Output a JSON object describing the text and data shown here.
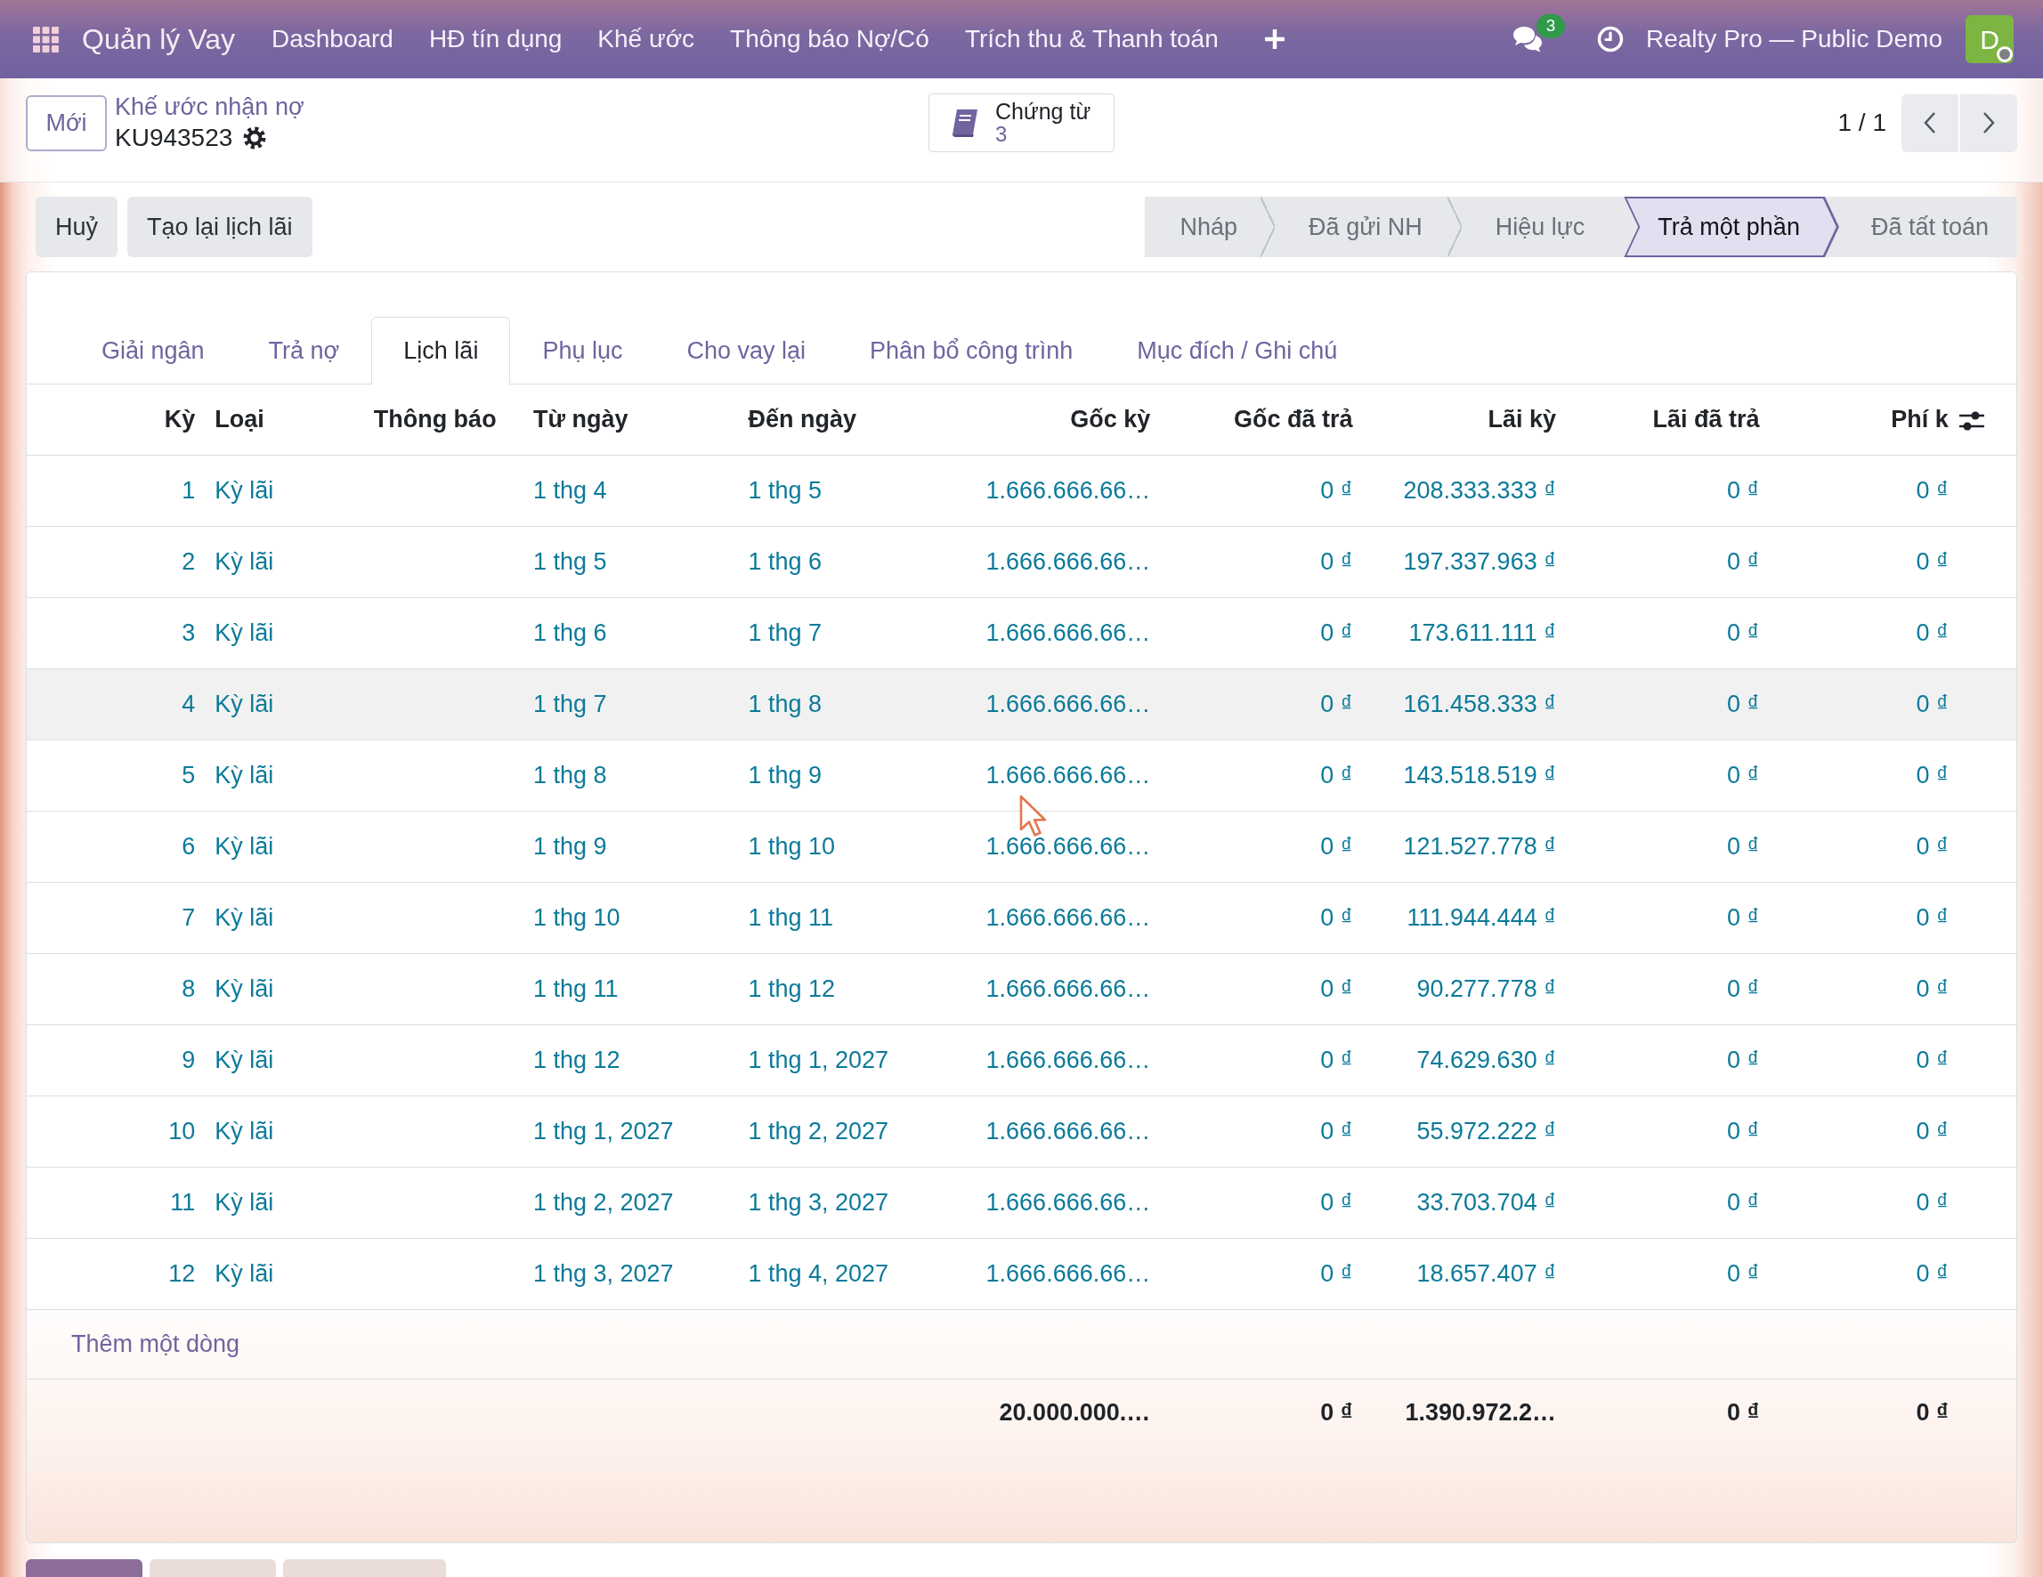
{
  "navbar": {
    "app_name": "Quản lý Vay",
    "menu": [
      "Dashboard",
      "HĐ tín dụng",
      "Khế ước",
      "Thông báo Nợ/Có",
      "Trích thu & Thanh toán"
    ],
    "message_count": "3",
    "company": "Realty Pro — Public Demo",
    "avatar_initial": "D"
  },
  "control_panel": {
    "new_button": "Mới",
    "breadcrumb": "Khế ước nhận nợ",
    "record_name": "KU943523",
    "smart_button": {
      "label": "Chứng từ",
      "count": "3"
    },
    "pager": "1 / 1"
  },
  "action_buttons": [
    "Huỷ",
    "Tạo lại lịch lãi"
  ],
  "status_bar": [
    {
      "label": "Nháp",
      "selected": false
    },
    {
      "label": "Đã gửi NH",
      "selected": false
    },
    {
      "label": "Hiệu lực",
      "selected": false
    },
    {
      "label": "Trả một phần",
      "selected": true
    },
    {
      "label": "Đã tất toán",
      "selected": false
    }
  ],
  "tabs": [
    {
      "label": "Giải ngân",
      "selected": false
    },
    {
      "label": "Trả nợ",
      "selected": false
    },
    {
      "label": "Lịch lãi",
      "selected": true
    },
    {
      "label": "Phụ lục",
      "selected": false
    },
    {
      "label": "Cho vay lại",
      "selected": false
    },
    {
      "label": "Phân bổ công trình",
      "selected": false
    },
    {
      "label": "Mục đích / Ghi chú",
      "selected": false
    }
  ],
  "table": {
    "columns": [
      {
        "label": "Kỳ",
        "kind": "number"
      },
      {
        "label": "Loại",
        "kind": "text"
      },
      {
        "label": "Thông báo",
        "kind": "text"
      },
      {
        "label": "Từ ngày",
        "kind": "text"
      },
      {
        "label": "Đến ngày",
        "kind": "text"
      },
      {
        "label": "Gốc kỳ",
        "kind": "number"
      },
      {
        "label": "Gốc đã trả",
        "kind": "number"
      },
      {
        "label": "Lãi kỳ",
        "kind": "number"
      },
      {
        "label": "Lãi đã trả",
        "kind": "number"
      },
      {
        "label": "Phí k",
        "kind": "number"
      }
    ],
    "rows": [
      {
        "hovered": false,
        "period": "1",
        "type": "Kỳ lãi",
        "from_date": "1 thg 4",
        "to_date": "1 thg 5",
        "principal": "1.666.666.66…",
        "principal_paid": "0 ₫",
        "interest": "208.333.333 ₫",
        "interest_paid": "0 ₫",
        "fee": "0 ₫"
      },
      {
        "hovered": false,
        "period": "2",
        "type": "Kỳ lãi",
        "from_date": "1 thg 5",
        "to_date": "1 thg 6",
        "principal": "1.666.666.66…",
        "principal_paid": "0 ₫",
        "interest": "197.337.963 ₫",
        "interest_paid": "0 ₫",
        "fee": "0 ₫"
      },
      {
        "hovered": false,
        "period": "3",
        "type": "Kỳ lãi",
        "from_date": "1 thg 6",
        "to_date": "1 thg 7",
        "principal": "1.666.666.66…",
        "principal_paid": "0 ₫",
        "interest": "173.611.111 ₫",
        "interest_paid": "0 ₫",
        "fee": "0 ₫"
      },
      {
        "hovered": true,
        "period": "4",
        "type": "Kỳ lãi",
        "from_date": "1 thg 7",
        "to_date": "1 thg 8",
        "principal": "1.666.666.66…",
        "principal_paid": "0 ₫",
        "interest": "161.458.333 ₫",
        "interest_paid": "0 ₫",
        "fee": "0 ₫"
      },
      {
        "hovered": false,
        "period": "5",
        "type": "Kỳ lãi",
        "from_date": "1 thg 8",
        "to_date": "1 thg 9",
        "principal": "1.666.666.66…",
        "principal_paid": "0 ₫",
        "interest": "143.518.519 ₫",
        "interest_paid": "0 ₫",
        "fee": "0 ₫"
      },
      {
        "hovered": false,
        "period": "6",
        "type": "Kỳ lãi",
        "from_date": "1 thg 9",
        "to_date": "1 thg 10",
        "principal": "1.666.666.66…",
        "principal_paid": "0 ₫",
        "interest": "121.527.778 ₫",
        "interest_paid": "0 ₫",
        "fee": "0 ₫"
      },
      {
        "hovered": false,
        "period": "7",
        "type": "Kỳ lãi",
        "from_date": "1 thg 10",
        "to_date": "1 thg 11",
        "principal": "1.666.666.66…",
        "principal_paid": "0 ₫",
        "interest": "111.944.444 ₫",
        "interest_paid": "0 ₫",
        "fee": "0 ₫"
      },
      {
        "hovered": false,
        "period": "8",
        "type": "Kỳ lãi",
        "from_date": "1 thg 11",
        "to_date": "1 thg 12",
        "principal": "1.666.666.66…",
        "principal_paid": "0 ₫",
        "interest": "90.277.778 ₫",
        "interest_paid": "0 ₫",
        "fee": "0 ₫"
      },
      {
        "hovered": false,
        "period": "9",
        "type": "Kỳ lãi",
        "from_date": "1 thg 12",
        "to_date": "1 thg 1, 2027",
        "principal": "1.666.666.66…",
        "principal_paid": "0 ₫",
        "interest": "74.629.630 ₫",
        "interest_paid": "0 ₫",
        "fee": "0 ₫"
      },
      {
        "hovered": false,
        "period": "10",
        "type": "Kỳ lãi",
        "from_date": "1 thg 1, 2027",
        "to_date": "1 thg 2, 2027",
        "principal": "1.666.666.66…",
        "principal_paid": "0 ₫",
        "interest": "55.972.222 ₫",
        "interest_paid": "0 ₫",
        "fee": "0 ₫"
      },
      {
        "hovered": false,
        "period": "11",
        "type": "Kỳ lãi",
        "from_date": "1 thg 2, 2027",
        "to_date": "1 thg 3, 2027",
        "principal": "1.666.666.66…",
        "principal_paid": "0 ₫",
        "interest": "33.703.704 ₫",
        "interest_paid": "0 ₫",
        "fee": "0 ₫"
      },
      {
        "hovered": false,
        "period": "12",
        "type": "Kỳ lãi",
        "from_date": "1 thg 3, 2027",
        "to_date": "1 thg 4, 2027",
        "principal": "1.666.666.66…",
        "principal_paid": "0 ₫",
        "interest": "18.657.407 ₫",
        "interest_paid": "0 ₫",
        "fee": "0 ₫"
      }
    ],
    "add_line": "Thêm một dòng",
    "totals": {
      "principal": "20.000.000.…",
      "principal_paid": "0 ₫",
      "interest": "1.390.972.2…",
      "interest_paid": "0 ₫",
      "fee": "0 ₫"
    }
  }
}
